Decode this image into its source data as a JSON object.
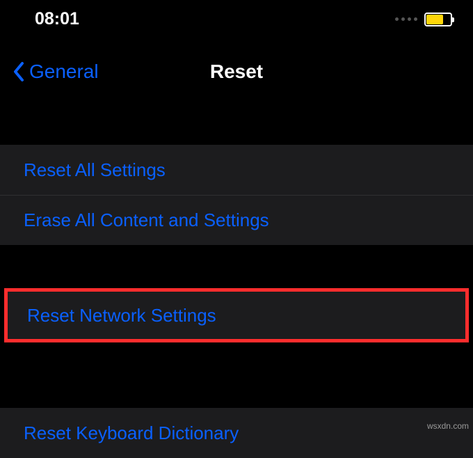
{
  "statusBar": {
    "time": "08:01"
  },
  "nav": {
    "backLabel": "General",
    "title": "Reset"
  },
  "groups": {
    "g1": {
      "resetAll": "Reset All Settings",
      "eraseAll": "Erase All Content and Settings"
    },
    "g2": {
      "resetNetwork": "Reset Network Settings"
    },
    "g3": {
      "resetKeyboard": "Reset Keyboard Dictionary"
    }
  },
  "watermark": "wsxdn.com"
}
